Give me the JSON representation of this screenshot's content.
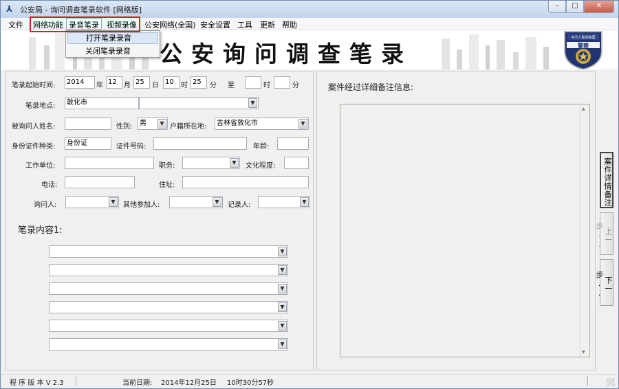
{
  "window": {
    "title": "公安局 - 询问调查笔录软件  [网络版]",
    "min_icon": "minimize-icon",
    "max_icon": "maximize-icon",
    "close_icon": "close-icon"
  },
  "menu": {
    "items": [
      "文件",
      "网络功能",
      "录音笔录",
      "视频录像",
      "公安网络(全国)",
      "安全设置",
      "工具",
      "更新",
      "帮助"
    ],
    "dropdown": [
      "打开笔录录音",
      "关闭笔录录音"
    ]
  },
  "banner": {
    "title": "公安询问调查笔录",
    "badge_top": "中华人民共和国",
    "badge_mid": "警察"
  },
  "form": {
    "start_time_label": "笔录起始时间:",
    "year": "2014",
    "year_unit": "年",
    "month": "12",
    "month_unit": "月",
    "day": "25",
    "day_unit": "日",
    "hour": "10",
    "hour_unit": "时",
    "minute": "25",
    "minute_unit": "分",
    "to_label": "至",
    "end_hour": "",
    "end_hour_unit": "时",
    "end_minute": "",
    "end_minute_unit": "分",
    "location_label": "笔录地点:",
    "location_value": "敦化市",
    "location_combo": "",
    "name_label": "被询问人姓名:",
    "name_value": "",
    "gender_label": "性别:",
    "gender_value": "男",
    "residence_label": "户籍所在地:",
    "residence_value": "吉林省敦化市",
    "id_type_label": "身份证件种类:",
    "id_type_value": "身份证",
    "id_no_label": "证件号码:",
    "id_no_value": "",
    "age_label": "年龄:",
    "age_value": "",
    "workplace_label": "工作单位:",
    "workplace_value": "",
    "position_label": "职务:",
    "position_value": "",
    "education_label": "文化程度:",
    "education_value": "",
    "phone_label": "电话:",
    "phone_value": "",
    "address_label": "住址:",
    "address_value": "",
    "interrogator_label": "询问人:",
    "others_label": "其他参加人:",
    "recorder_label": "记录人:",
    "content_title": "笔录内容1:",
    "content_rows": [
      "",
      "",
      "",
      "",
      "",
      ""
    ]
  },
  "notes": {
    "label": "案件经过详细备注信息:"
  },
  "side_buttons": {
    "notes": "案件详情备注",
    "prev": "上一步..",
    "next": "下一步.."
  },
  "status": {
    "version": "程 序 版 本 V 2.3",
    "date_label": "当前日期:",
    "date_value": "2014年12月25日",
    "time_value": "10时30分57秒"
  }
}
